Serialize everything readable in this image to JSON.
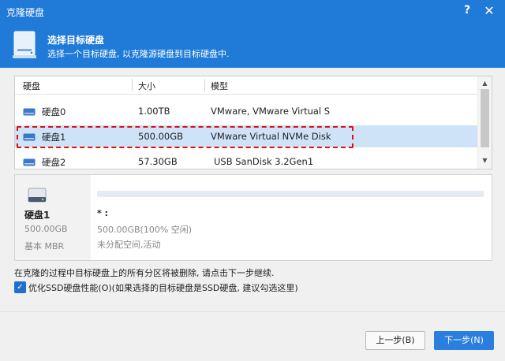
{
  "window": {
    "title": "克隆硬盘",
    "help_glyph": "?",
    "close_glyph": "✕"
  },
  "header": {
    "title": "选择目标硬盘",
    "subtitle": "选择一个目标硬盘, 以克隆源硬盘到目标硬盘中."
  },
  "table": {
    "columns": [
      "硬盘",
      "大小",
      "模型"
    ],
    "rows": [
      {
        "disk": "硬盘0",
        "size": "1.00TB",
        "model": "VMware, VMware Virtual S"
      },
      {
        "disk": "硬盘1",
        "size": "500.00GB",
        "model": "VMware Virtual NVMe Disk"
      },
      {
        "disk": "硬盘2",
        "size": "57.30GB",
        "model": "USB SanDisk 3.2Gen1"
      }
    ],
    "selected_row": 1
  },
  "detail": {
    "disk_name": "硬盘1",
    "disk_size": "500.00GB",
    "disk_type": "基本 MBR",
    "partition_label": "* :",
    "partition_info": "500.00GB(100% 空闲)",
    "partition_status": "未分配空间,活动"
  },
  "warning": "在克隆的过程中目标硬盘上的所有分区将被删除, 请点击下一步继续.",
  "option": {
    "label": "优化SSD硬盘性能(O)(如果选择的目标硬盘是SSD硬盘, 建议勾选这里)",
    "checked": true
  },
  "buttons": {
    "prev": "上一步(B)",
    "next": "下一步(N)"
  },
  "colors": {
    "accent": "#1f7ad8",
    "selection": "#cfe3f8",
    "highlight_border": "#e01010"
  }
}
